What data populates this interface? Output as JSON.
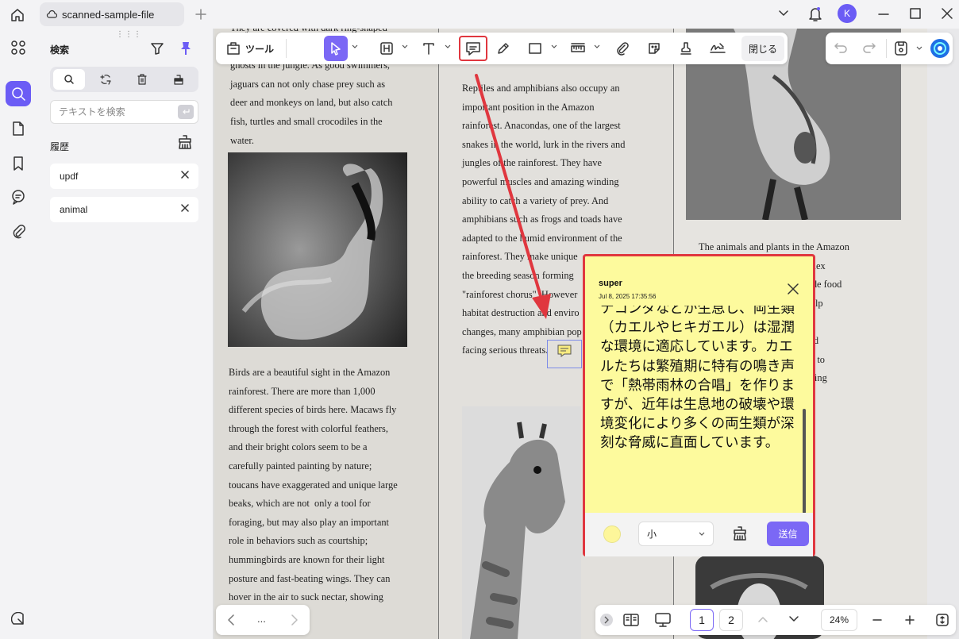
{
  "titlebar": {
    "tab_title": "scanned-sample-file",
    "avatar_letter": "K"
  },
  "panel": {
    "title": "検索",
    "search_placeholder": "テキストを検索",
    "history_title": "履歴",
    "history": [
      "updf",
      "animal"
    ]
  },
  "toolbar": {
    "tools_label": "ツール",
    "close_label": "閉じる"
  },
  "document": {
    "col1_top": "They are covered with dark ring-shaped\nspots that appear a\nghosts in the jungle. As good swimmers,\njaguars can not only chase prey such as\ndeer and monkeys on land, but also catch\nfish, turtles and small crocodiles in the\nwater.",
    "col1_bottom": "Birds are a beautiful sight in the Amazon\nrainforest. There are more than 1,000\ndifferent species of birds here. Macaws fly\nthrough the forest with colorful feathers,\nand their bright colors seem to be a\ncarefully painted painting by nature;\ntoucans have exaggerated and unique large\nbeaks, which are not  only a tool for\nforaging, but may also play an important\nrole in behaviors such as courtship;\nhummingbirds are known for their light\nposture and fast-beating wings. They can\nhover in the air to suck nectar, showing\n                    skills.",
    "col2_top": "Reptiles and amphibians also occupy an\nimportant position in the Amazon\nrainforest. Anacondas, one of the largest\nsnakes in the world, lurk in the rivers and\njungles of the rainforest. They have\npowerful muscles and amazing winding\nability to catch a variety of prey. And\namphibians such as frogs and toads have\nadapted to the humid environment of the\nrainforest. They make unique\nthe breeding season forming\n\"rainforest chorus\". However\nhabitat destruction and enviro\nchanges, many amphibian pop\nfacing serious threats.",
    "col3_text": "The animals and plants in the Amazon\n                                g a complex\n                                nts provide food\n                                nimals help\n                                ol the\n                                , birds and\n                                ead seeds to\n                                s, promoting\n                                hile some\n                                lants and\n                                on in the"
  },
  "comment": {
    "author": "super",
    "time": "Jul 8, 2025 17:35:56",
    "body": "ナコンダなどが生息し、両生類（カエルやヒキガエル）は湿潤な環境に適応しています。カエルたちは繁殖期に特有の鳴き声で「熱帯雨林の合唱」を作りますが、近年は生息地の破壊や環境変化により多くの両生類が深刻な脅威に直面しています。",
    "font_size_value": "小",
    "send_label": "送信",
    "note_color": "#fdf69a"
  },
  "pagination": {
    "pages": [
      "1",
      "2"
    ],
    "current": "1",
    "zoom": "24%",
    "more": "..."
  },
  "colors": {
    "accent": "#7b68f5",
    "highlight_red": "#e0373f"
  }
}
